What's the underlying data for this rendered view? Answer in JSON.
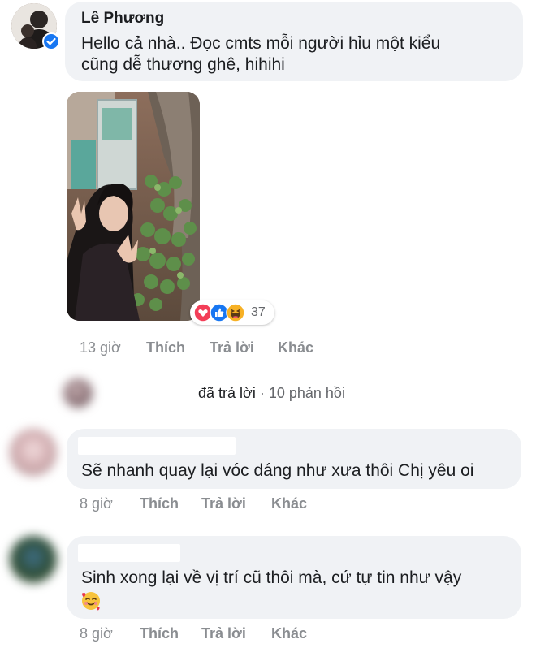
{
  "comments": [
    {
      "name": "Lê Phương",
      "text_line1": "Hello cả nhà.. Đọc cmts mỗi người hỉu một kiểu",
      "text_line2": "cũng dễ thương ghê, hihihi",
      "reaction_count": "37",
      "time": "13 giờ",
      "like": "Thích",
      "reply": "Trả lời",
      "more": "Khác"
    },
    {
      "text": "Sẽ nhanh quay lại vóc dáng như xưa thôi Chị yêu oi",
      "time": "8 giờ",
      "like": "Thích",
      "reply": "Trả lời",
      "more": "Khác"
    },
    {
      "text": "Sinh xong lại về vị trí cũ thôi mà, cứ tự tin như vậy",
      "time": "8 giờ",
      "like": "Thích",
      "reply": "Trả lời",
      "more": "Khác"
    }
  ],
  "replies_summary": {
    "replied": "đã trả lời",
    "count": "· 10 phản hồi"
  },
  "icons": {
    "verified": "verified-badge-icon",
    "love": "love-reaction-icon",
    "like": "like-reaction-icon",
    "haha": "haha-reaction-icon",
    "emoji": "smiling-face-with-hearts-icon"
  },
  "colors": {
    "bubble": "#f0f2f5",
    "meta": "#8a8d91",
    "verified": "#1877f2"
  }
}
